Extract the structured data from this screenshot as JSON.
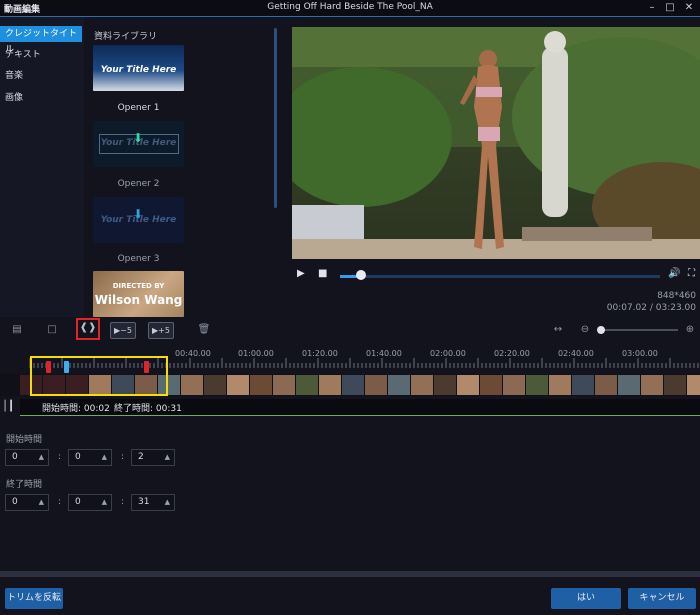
{
  "window": {
    "app_title": "動画編集",
    "file_title": "Getting Off Hard Beside The Pool_NA",
    "controls": [
      "minimize-icon",
      "maximize-icon",
      "close-icon"
    ]
  },
  "left_menu": {
    "items": [
      {
        "label": "クレジットタイトル",
        "active": true
      },
      {
        "label": "テキスト",
        "active": false
      },
      {
        "label": "音楽",
        "active": false
      },
      {
        "label": "画像",
        "active": false
      }
    ]
  },
  "library": {
    "title": "資料ライブラリ",
    "items": [
      {
        "thumb_text": "Your Title Here",
        "label": "Opener 1"
      },
      {
        "thumb_text": "Your Title Here",
        "label": "Opener 2"
      },
      {
        "thumb_text": "Your Title Here",
        "label": "Opener 3"
      },
      {
        "thumb_text_small": "DIRECTED BY",
        "thumb_text": "Wilson Wang",
        "label": ""
      }
    ]
  },
  "player": {
    "progress": 0.02,
    "resolution": "848*460",
    "timecode": "00:07.02 / 03:23.00"
  },
  "toolbar": {
    "skip_back": "▶−5",
    "skip_fwd": "▶+5"
  },
  "ruler": {
    "labels": [
      "00:40.00",
      "01:00.00",
      "01:20.00",
      "01:40.00",
      "02:00.00",
      "02:20.00",
      "02:40.00",
      "03:00.00"
    ]
  },
  "trim": {
    "start_display": "開始時間: 00:02",
    "end_display": "終了時間: 00:31",
    "start_label": "開始時間",
    "end_label": "終了時間",
    "start": {
      "h": "0",
      "m": "0",
      "s": "2"
    },
    "end": {
      "h": "0",
      "m": "0",
      "s": "31"
    },
    "colon": ":"
  },
  "buttons": {
    "reverse": "トリムを反転",
    "ok": "はい",
    "cancel": "キャンセル"
  },
  "colors": {
    "accent": "#1f8fe0",
    "selection": "#f3e000",
    "highlight_box": "#e0242a"
  }
}
